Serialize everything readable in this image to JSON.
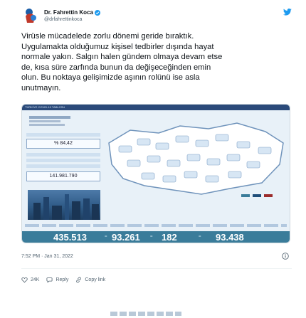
{
  "author": {
    "display_name": "Dr. Fahrettin Koca",
    "handle": "@drfahrettinkoca",
    "verified": true,
    "avatar_icon": "avatar-image"
  },
  "tweet": {
    "text": "Virüsle mücadelede zorlu dönemi geride bıraktık.\nUygulamakta olduğumuz kişisel tedbirler dışında hayat\nnormale yakın. Salgın halen gündem olmaya devam etse\nde, kısa süre zarfında bunun da değişeceğinden emin\nolun. Bu noktaya gelişimizde aşının rolünü ise asla\nunutmayın."
  },
  "media": {
    "header_text": "TÜRKİYE COVID-19 TABLOSU",
    "left_panel": {
      "rate": "% 84,42",
      "total": "141.981.790"
    },
    "counts": [
      "435.513",
      "93.261",
      "182",
      "93.438"
    ]
  },
  "meta": {
    "timestamp": "7:52 PM · Jan 31, 2022"
  },
  "actions": {
    "like_count": "24K",
    "reply_label": "Reply",
    "copy_label": "Copy link"
  },
  "colors": {
    "twitter_blue": "#1d9bf0",
    "counts_bar": "#3a7c9a",
    "text": "#0f1419",
    "secondary": "#536471"
  }
}
